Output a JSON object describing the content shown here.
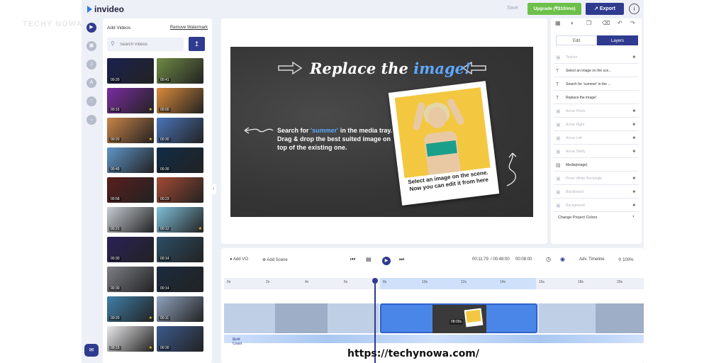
{
  "app": {
    "name": "invideo"
  },
  "header": {
    "save_label": "Save",
    "upgrade_label": "Upgrade (₹$10/mo)",
    "export_label": "Export",
    "info_label": "i"
  },
  "media_panel": {
    "title": "Add Videos",
    "remove_watermark": "Remove Watermark",
    "search_placeholder": "Search Videos",
    "thumbnails": [
      {
        "duration": "00:20",
        "color": "#1b2150",
        "premium": false
      },
      {
        "duration": "00:41",
        "color": "#6f8a44",
        "premium": false
      },
      {
        "duration": "00:15",
        "color": "#7a2da0",
        "premium": true
      },
      {
        "duration": "00:00",
        "color": "#d98a3a",
        "premium": false
      },
      {
        "duration": "00:20",
        "color": "#c98348",
        "premium": true
      },
      {
        "duration": "00:30",
        "color": "#4a74b8",
        "premium": false
      },
      {
        "duration": "00:40",
        "color": "#5f95c8",
        "premium": false
      },
      {
        "duration": "00:30",
        "color": "#102c46",
        "premium": false
      },
      {
        "duration": "00:58",
        "color": "#5a1e1e",
        "premium": false
      },
      {
        "duration": "00:23",
        "color": "#a34a34",
        "premium": false
      },
      {
        "duration": "00:21",
        "color": "#c6ccd3",
        "premium": false
      },
      {
        "duration": "00:12",
        "color": "#7fbfd8",
        "premium": true
      },
      {
        "duration": "00:30",
        "color": "#2a2158",
        "premium": false
      },
      {
        "duration": "00:14",
        "color": "#2d4e66",
        "premium": false
      },
      {
        "duration": "00:30",
        "color": "#7d7f86",
        "premium": false
      },
      {
        "duration": "00:14",
        "color": "#1c2b3f",
        "premium": false
      },
      {
        "duration": "00:20",
        "color": "#3f7fa8",
        "premium": true
      },
      {
        "duration": "00:11",
        "color": "#8fa2bd",
        "premium": false
      },
      {
        "duration": "00:15",
        "color": "#e8e8ea",
        "premium": true
      },
      {
        "duration": "00:30",
        "color": "#3c5a8c",
        "premium": false
      }
    ]
  },
  "scene": {
    "headline_pre": "Replace the ",
    "headline_highlight": "image!",
    "instr_pre": "Search for ",
    "instr_quote": "'summer'",
    "instr_post": " in the media tray. Drag & drop the best suited image on top of the existing one.",
    "caption": "Select an image on the scene. Now you can edit it from here"
  },
  "right_panel": {
    "tabs": [
      {
        "label": "Edit"
      },
      {
        "label": "Layers"
      }
    ],
    "layers": [
      {
        "label": "Texture",
        "icon": "image-icon",
        "dim": true,
        "locked": true
      },
      {
        "label": "Select an image on the sce...",
        "icon": "text-icon",
        "dim": false,
        "locked": false
      },
      {
        "label": "Search for 'summer' in the ...",
        "icon": "text-icon",
        "dim": false,
        "locked": false
      },
      {
        "label": "Replace the image!",
        "icon": "text-icon",
        "dim": false,
        "locked": false
      },
      {
        "label": "Arrow Photo",
        "icon": "image-icon",
        "dim": true,
        "locked": true
      },
      {
        "label": "Arrow Right",
        "icon": "image-icon",
        "dim": true,
        "locked": true
      },
      {
        "label": "Arrow Left",
        "icon": "image-icon",
        "dim": true,
        "locked": true
      },
      {
        "label": "Arrow Swirly",
        "icon": "image-icon",
        "dim": true,
        "locked": true
      },
      {
        "label": "Media(image)",
        "icon": "media-icon",
        "dim": false,
        "locked": false
      },
      {
        "label": "Photo White Rectangle",
        "icon": "image-icon",
        "dim": true,
        "locked": true
      },
      {
        "label": "Blackboard",
        "icon": "image-icon",
        "dim": true,
        "locked": true
      },
      {
        "label": "Background",
        "icon": "image-icon",
        "dim": true,
        "locked": true
      }
    ],
    "change_colors": "Change Project Colors"
  },
  "timeline": {
    "add_vo": "Add VO",
    "add_scene": "Add Scene",
    "time_current": "00:11:79",
    "time_total": "/ 00:48:00",
    "scene_duration": "00:08:00",
    "adv_timeline": "Adv. Timeline",
    "zoom": "100%",
    "ticks": [
      "0s",
      "2s",
      "4s",
      "6s",
      "8s",
      "10s",
      "12s",
      "14s",
      "16s",
      "18s",
      "20s"
    ],
    "selected_badge": "08:00s",
    "audio_label": "Gold Coast"
  },
  "watermark": "https://techynowa.com/",
  "corner_logo": "TECHY NOWA"
}
